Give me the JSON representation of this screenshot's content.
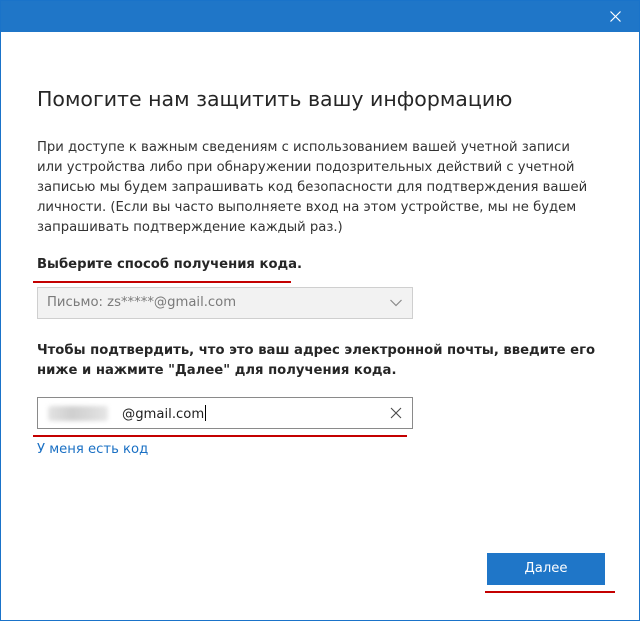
{
  "window": {
    "accent_color": "#1f76c8",
    "close_icon": "close-icon"
  },
  "page": {
    "title": "Помогите нам защитить вашу информацию",
    "description": "При доступе к важным сведениям с использованием вашей учетной записи или устройства либо при обнаружении подозрительных действий с учетной записью мы будем запрашивать код безопасности для подтверждения вашей личности. (Если вы часто выполняете вход на этом устройстве, мы не будем запрашивать подтверждение каждый раз.)",
    "choose_method_label": "Выберите способ получения кода.",
    "instruction": "Чтобы подтвердить, что это ваш адрес электронной почты, введите его ниже и нажмите \"Далее\" для получения кода.",
    "have_code_link": "У меня есть код"
  },
  "method_select": {
    "selected_value": "Письмо: zs*****@gmail.com",
    "icon": "chevron-down-icon"
  },
  "email_input": {
    "value": "@gmail.com",
    "clear_icon": "clear-icon"
  },
  "actions": {
    "next_label": "Далее"
  },
  "highlight_color": "#c40000"
}
